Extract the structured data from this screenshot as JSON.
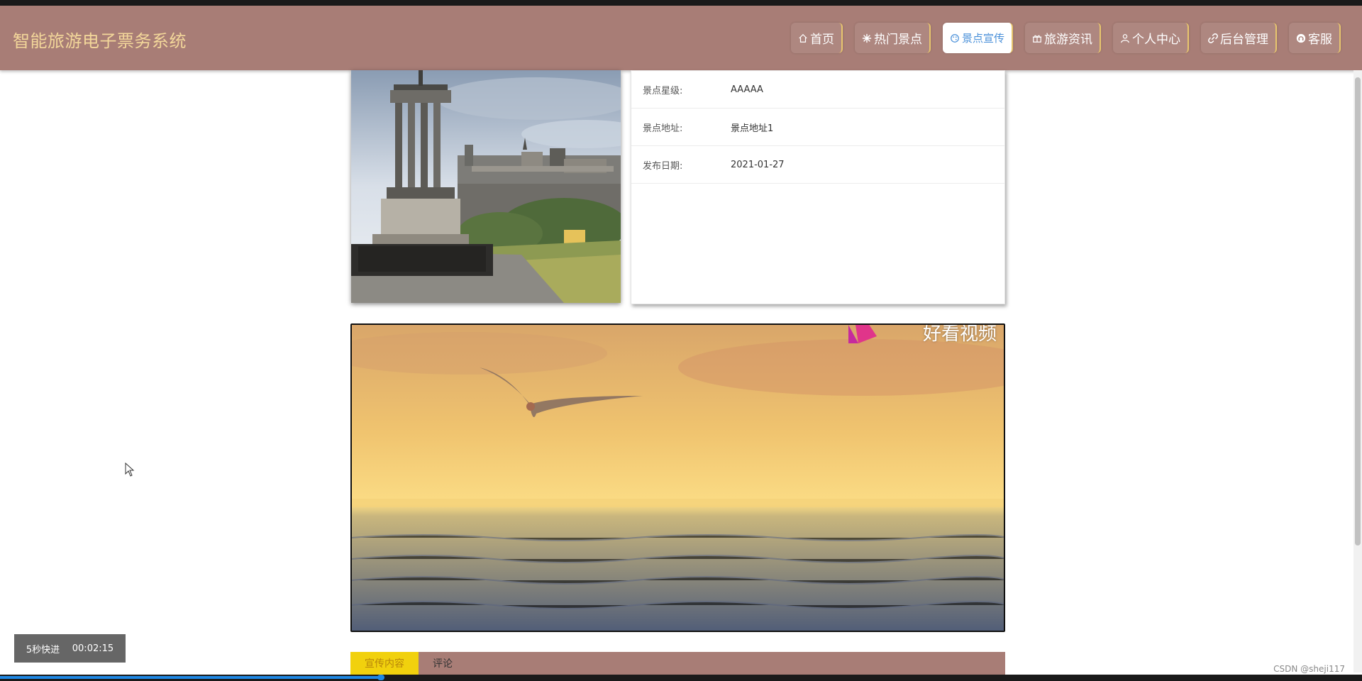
{
  "app": {
    "title": "智能旅游电子票务系统"
  },
  "nav": [
    {
      "label": "首页",
      "icon": "home-icon"
    },
    {
      "label": "热门景点",
      "icon": "snowflake-icon"
    },
    {
      "label": "景点宣传",
      "icon": "palette-icon",
      "active": true
    },
    {
      "label": "旅游资讯",
      "icon": "gift-icon"
    },
    {
      "label": "个人中心",
      "icon": "user-icon"
    },
    {
      "label": "后台管理",
      "icon": "link-icon"
    },
    {
      "label": "客服",
      "icon": "headset-icon"
    }
  ],
  "details": [
    {
      "label": "景点星级:",
      "value": "AAAAA"
    },
    {
      "label": "景点地址:",
      "value": "景点地址1"
    },
    {
      "label": "发布日期:",
      "value": "2021-01-27"
    }
  ],
  "video": {
    "watermark_top": "好看视频"
  },
  "tabs": [
    {
      "label": "宣传内容",
      "active": true
    },
    {
      "label": "评论"
    }
  ],
  "player": {
    "speed_label": "5秒快进",
    "time": "00:02:15",
    "progress_fraction": 0.28
  },
  "footer": {
    "watermark": "CSDN @sheji117"
  },
  "colors": {
    "header_bg": "#a87d76",
    "logo": "#f3d79a",
    "accent": "#e8c66e",
    "active_text": "#4a90d9",
    "tab_active": "#f1d10d"
  }
}
